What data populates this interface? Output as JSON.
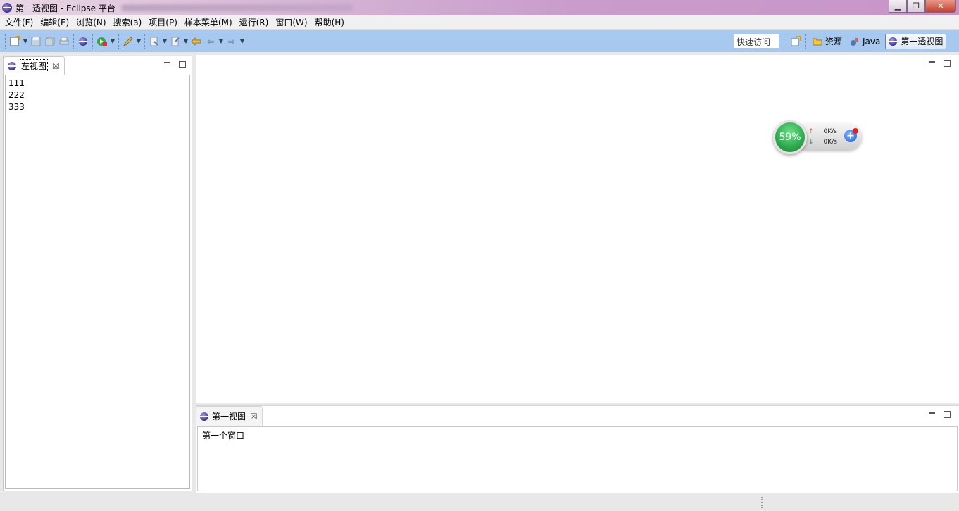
{
  "window": {
    "title": "第一透视图 - Eclipse 平台",
    "controls": {
      "minimize": "▁",
      "maximize": "❐",
      "close": "✕"
    }
  },
  "menu": {
    "items": [
      "文件(F)",
      "编辑(E)",
      "浏览(N)",
      "搜索(a)",
      "项目(P)",
      "样本菜单(M)",
      "运行(R)",
      "窗口(W)",
      "帮助(H)"
    ]
  },
  "toolbar": {
    "quick_access_label": "快速访问",
    "perspectives": [
      {
        "label": "资源",
        "icon": "resource-folder-icon"
      },
      {
        "label": "Java",
        "icon": "java-icon"
      },
      {
        "label": "第一透视图",
        "icon": "eclipse-icon",
        "active": true
      }
    ]
  },
  "left_view": {
    "tab_label": "左视图",
    "items": [
      "111",
      "222",
      "333"
    ]
  },
  "bottom_view": {
    "tab_label": "第一视图",
    "content": "第一个窗口"
  },
  "net_widget": {
    "percent": "59%",
    "upload": "0K/s",
    "download": "0K/s"
  },
  "colors": {
    "toolbar_bg": "#a7c9ef",
    "titlebar_accent": "#c995c9",
    "widget_green": "#2da94c"
  }
}
